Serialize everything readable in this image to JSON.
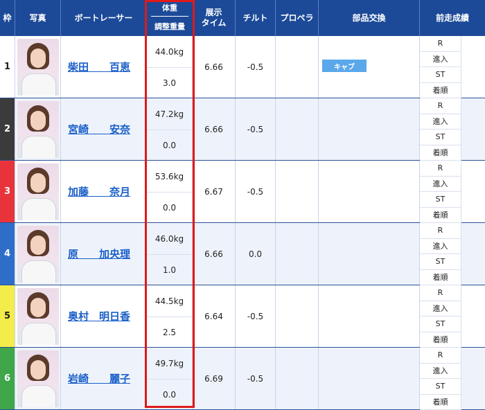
{
  "header": {
    "waku": "枠",
    "photo": "写真",
    "racer": "ボートレーサー",
    "weight": "体重",
    "adjust": "調整重量",
    "exhibit_line1": "展示",
    "exhibit_line2": "タイム",
    "tilt": "チルト",
    "propeller": "プロペラ",
    "parts": "部品交換",
    "prev": "前走成績"
  },
  "record_labels": [
    "R",
    "進入",
    "ST",
    "着順"
  ],
  "rows": [
    {
      "waku": "1",
      "color": "#ffffff",
      "text_color": "#222222",
      "name": "柴田　　百恵",
      "weight": "44.0kg",
      "adjust": "3.0",
      "time": "6.66",
      "tilt": "-0.5",
      "parts": "キャブ"
    },
    {
      "waku": "2",
      "color": "#3b3b3b",
      "text_color": "#ffffff",
      "name": "宮崎　　安奈",
      "weight": "47.2kg",
      "adjust": "0.0",
      "time": "6.66",
      "tilt": "-0.5",
      "parts": ""
    },
    {
      "waku": "3",
      "color": "#e8333a",
      "text_color": "#ffffff",
      "name": "加藤　　奈月",
      "weight": "53.6kg",
      "adjust": "0.0",
      "time": "6.67",
      "tilt": "-0.5",
      "parts": ""
    },
    {
      "waku": "4",
      "color": "#2f6ec8",
      "text_color": "#ffffff",
      "name": "原　　加央理",
      "weight": "46.0kg",
      "adjust": "1.0",
      "time": "6.66",
      "tilt": "0.0",
      "parts": ""
    },
    {
      "waku": "5",
      "color": "#f3ec4a",
      "text_color": "#222222",
      "name": "奥村　明日香",
      "weight": "44.5kg",
      "adjust": "2.5",
      "time": "6.64",
      "tilt": "-0.5",
      "parts": ""
    },
    {
      "waku": "6",
      "color": "#3fa64a",
      "text_color": "#ffffff",
      "name": "岩崎　　麗子",
      "weight": "49.7kg",
      "adjust": "0.0",
      "time": "6.69",
      "tilt": "-0.5",
      "parts": ""
    }
  ],
  "colors": {
    "header_bg": "#1c4a98",
    "link": "#1a5fc8",
    "highlight": "#e01919",
    "badge": "#5aa8ea"
  }
}
